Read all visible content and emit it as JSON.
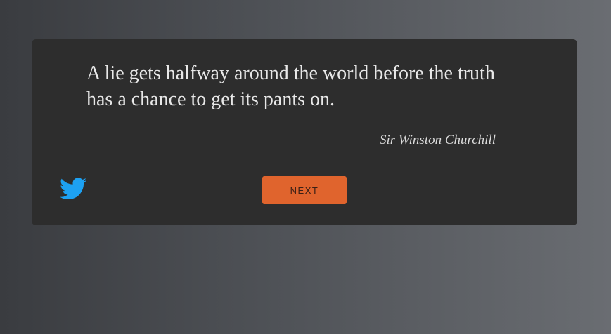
{
  "quote": {
    "text": "A lie gets halfway around the world before the truth has a chance to get its pants on.",
    "author": "Sir Winston Churchill"
  },
  "actions": {
    "tweet_icon": "twitter-bird-icon",
    "next_label": "NEXT"
  },
  "colors": {
    "card_background": "#2d2d2d",
    "accent": "#e0642d",
    "twitter_blue": "#1da1f2",
    "quote_text": "#e8e8e8"
  }
}
